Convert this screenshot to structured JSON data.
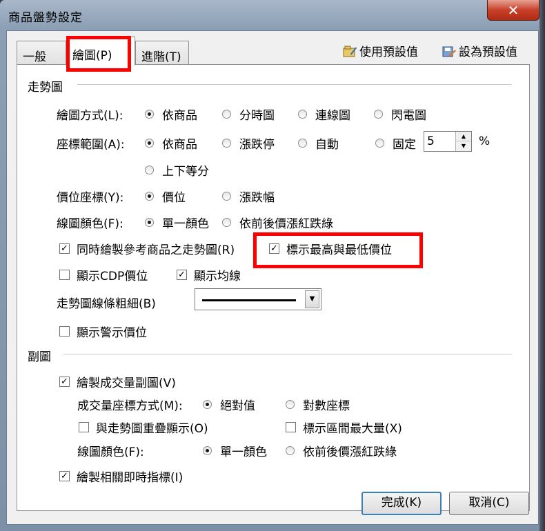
{
  "window": {
    "title": "商品盤勢設定",
    "close_label": "✕"
  },
  "tabs": [
    {
      "label": "一般(D)",
      "active": false
    },
    {
      "label": "繪圖(P)",
      "active": true
    },
    {
      "label": "進階(T)",
      "active": false
    }
  ],
  "toolbar": {
    "use_default": "使用預設值",
    "set_default": "設為預設值"
  },
  "trend": {
    "group_title": "走勢圖",
    "draw_mode": {
      "label": "繪圖方式(L):",
      "options": [
        "依商品",
        "分時圖",
        "連線圖",
        "閃電圖"
      ],
      "selected": 0
    },
    "coord_range": {
      "label": "座標範圍(A):",
      "options": [
        "依商品",
        "漲跌停",
        "自動",
        "固定"
      ],
      "option5": "上下等分",
      "selected": 0,
      "fixed_value": "5",
      "unit": "%"
    },
    "price_coord": {
      "label": "價位座標(Y):",
      "options": [
        "價位",
        "漲跌幅"
      ],
      "selected": 0
    },
    "line_color": {
      "label": "線圖顏色(F):",
      "options": [
        "單一顏色",
        "依前後價漲紅跌綠"
      ],
      "selected": 0
    },
    "draw_ref": {
      "label": "同時繪製參考商品之走勢圖(R)",
      "checked": true
    },
    "mark_high_low": {
      "label": "標示最高與最低價位",
      "checked": true
    },
    "show_cdp": {
      "label": "顯示CDP價位",
      "checked": false
    },
    "show_avg": {
      "label": "顯示均線",
      "checked": true
    },
    "line_width": {
      "label": "走勢圖線條粗細(B)"
    },
    "show_warning": {
      "label": "顯示警示價位",
      "checked": false
    }
  },
  "sub": {
    "group_title": "副圖",
    "draw_volume": {
      "label": "繪製成交量副圖(V)",
      "checked": true
    },
    "vol_coord": {
      "label": "成交量座標方式(M):",
      "options": [
        "絕對值",
        "對數座標"
      ],
      "selected": 0
    },
    "overlay": {
      "label": "與走勢圖重疊顯示(O)",
      "checked": false
    },
    "mark_max": {
      "label": "標示區間最大量(X)",
      "checked": false
    },
    "line_color": {
      "label": "線圖顏色(F):",
      "options": [
        "單一顏色",
        "依前後價漲紅跌綠"
      ],
      "selected": 0
    },
    "draw_indicator": {
      "label": "繪製相關即時指標(I)",
      "checked": true
    }
  },
  "buttons": {
    "ok": "完成(K)",
    "cancel": "取消(C)"
  },
  "colors": {
    "highlight": "#ff0000",
    "title_bar": "#8c9fb5",
    "close": "#c8412a"
  }
}
